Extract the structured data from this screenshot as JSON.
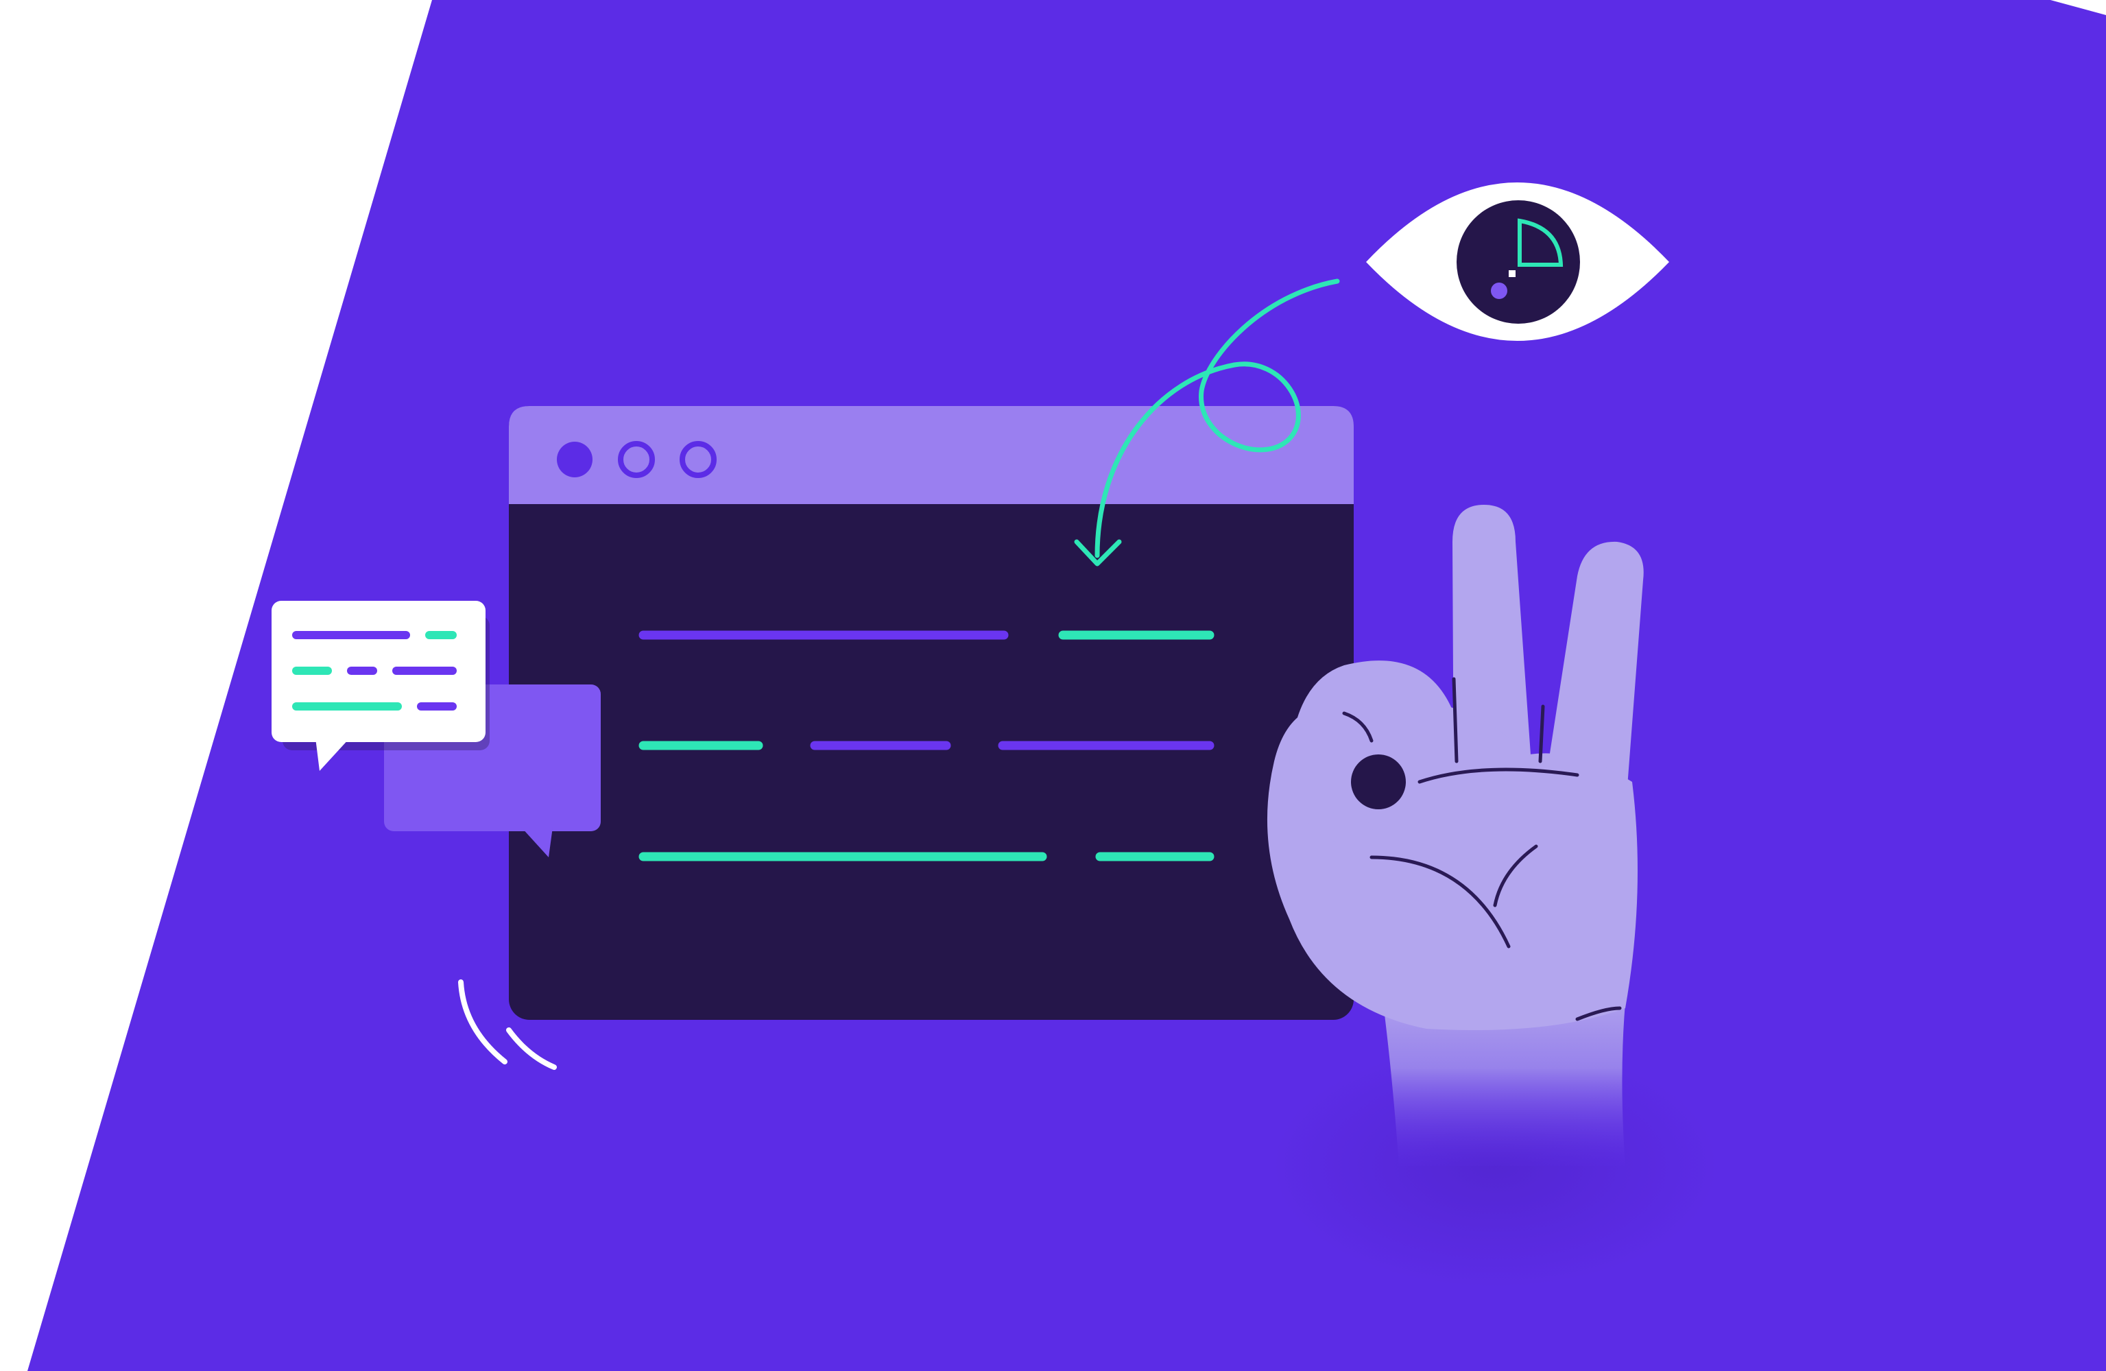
{
  "illustration": {
    "subject": "code-review-illustration",
    "elements": [
      "browser-window",
      "window-control-dots",
      "code-lines",
      "chat-bubbles",
      "eye-icon",
      "curly-arrow",
      "ok-hand-gesture",
      "motion-marks"
    ]
  },
  "colors": {
    "page_background": "#ffffff",
    "violet_panel": "#5c2ce6",
    "window_titlebar": "#9a7ff0",
    "window_body": "#25164a",
    "teal_accent": "#2ee6b6",
    "violet_line": "#6a35f0",
    "hand": "#b3a6ee",
    "bubble_white": "#ffffff",
    "bubble_violet": "#7f57f2",
    "outline_dark": "#2a1a55"
  },
  "icons": [
    "eye-icon",
    "arrow-icon",
    "hand-ok-icon",
    "chat-bubble-icon",
    "window-dot-icon"
  ]
}
